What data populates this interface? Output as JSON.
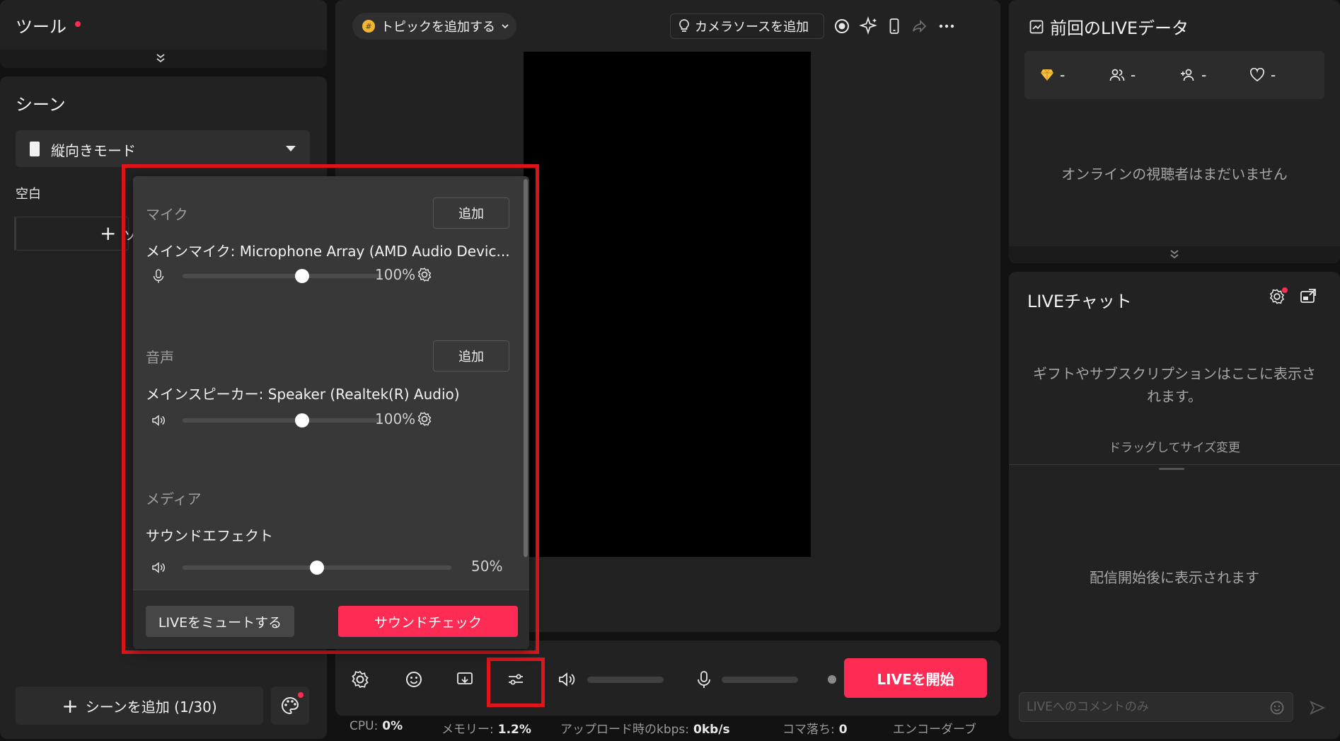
{
  "tools": {
    "title": "ツール"
  },
  "scene": {
    "title": "シーン",
    "mode_selected": "縦向きモード",
    "blank_label": "空白",
    "source_button_partial": "ソ",
    "add_scene_label": "シーンを追加 (1/30)"
  },
  "center": {
    "topic_button": "トピックを追加する",
    "camera_source_button": "カメラソースを追加"
  },
  "bottom": {
    "go_live": "LIVEを開始"
  },
  "status": {
    "cpu_label": "CPU:",
    "cpu_value": "0%",
    "memory_label": "メモリー:",
    "memory_value": "1.2%",
    "upload_label": "アップロード時のkbps:",
    "upload_value": "0kb/s",
    "dropped_label": "コマ落ち:",
    "dropped_value": "0",
    "encoder_label": "エンコーダーブ"
  },
  "prev_live": {
    "title": "前回のLIVEデータ",
    "stats": [
      "-",
      "-",
      "-",
      "-"
    ],
    "empty_message": "オンラインの視聴者はまだいません"
  },
  "chat": {
    "title": "LIVEチャット",
    "gift_message": "ギフトやサブスクリプションはここに表示されます。",
    "drag_hint": "ドラッグしてサイズ変更",
    "after_start_message": "配信開始後に表示されます",
    "input_placeholder": "LIVEへのコメントのみ"
  },
  "mixer": {
    "mic_section": "マイク",
    "mic_add": "追加",
    "mic_device": "メインマイク: Microphone Array (AMD Audio Devic...",
    "mic_volume_label": "100%",
    "mic_volume": 0.6,
    "audio_section": "音声",
    "audio_add": "追加",
    "speaker_device": "メインスピーカー: Speaker (Realtek(R) Audio)",
    "speaker_volume_label": "100%",
    "speaker_volume": 0.6,
    "media_section": "メディア",
    "sfx_name": "サウンドエフェクト",
    "sfx_volume_label": "50%",
    "sfx_volume": 0.5,
    "mute_live": "LIVEをミュートする",
    "sound_check": "サウンドチェック"
  },
  "colors": {
    "accent": "#fe2c55",
    "highlight": "#e0141b",
    "panel": "#222222",
    "background": "#121212"
  }
}
